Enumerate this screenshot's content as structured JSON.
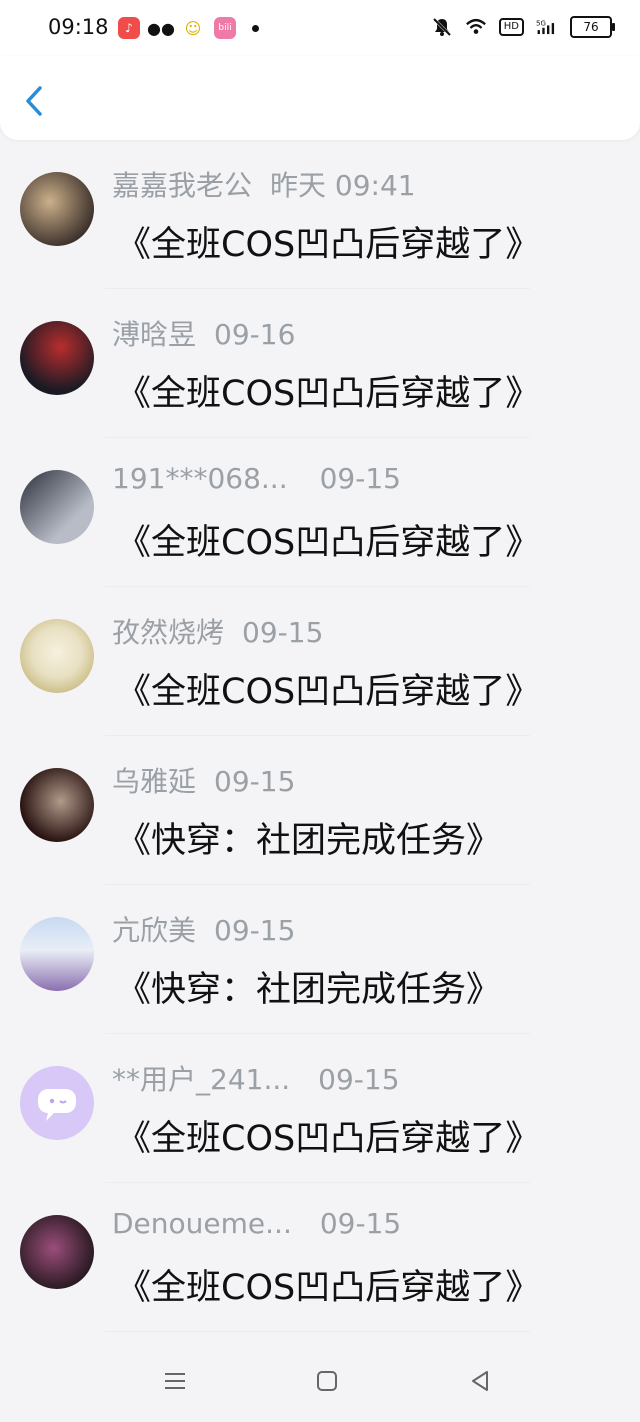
{
  "status_bar": {
    "time": "09:18",
    "battery": "76",
    "hd": "HD",
    "signal": "5G"
  },
  "header": {
    "back_icon": "chevron-left-icon"
  },
  "list": [
    {
      "name": "嘉嘉我老公",
      "time": "昨天 09:41",
      "message": "《全班COS凹凸后穿越了》",
      "avatar_colors": [
        "#3a2f2a",
        "#cbb08a"
      ]
    },
    {
      "name": "溥晗昱",
      "time": "09-16",
      "message": "《全班COS凹凸后穿越了》",
      "avatar_colors": [
        "#1a1a24",
        "#b82d2d"
      ]
    },
    {
      "name": "191***068...",
      "time": "09-15",
      "message": "《全班COS凹凸后穿越了》",
      "avatar_colors": [
        "#2b2f3a",
        "#b7bcc7"
      ]
    },
    {
      "name": "孜然烧烤",
      "time": "09-15",
      "message": "《全班COS凹凸后穿越了》",
      "avatar_colors": [
        "#e8e0c2",
        "#b6a35a"
      ]
    },
    {
      "name": "乌雅延",
      "time": "09-15",
      "message": "《快穿：社团完成任务》",
      "avatar_colors": [
        "#2a1412",
        "#b09a8a"
      ]
    },
    {
      "name": "亢欣美",
      "time": "09-15",
      "message": "《快穿：社团完成任务》",
      "avatar_colors": [
        "#c7d9f2",
        "#8b6fb0"
      ]
    },
    {
      "name": "**用户_241...",
      "time": "09-15",
      "message": "《全班COS凹凸后穿越了》",
      "avatar_colors": [
        "#d7c8f7",
        "#ffffff"
      ]
    },
    {
      "name": "Denoueme...",
      "time": "09-15",
      "message": "《全班COS凹凸后穿越了》",
      "avatar_colors": [
        "#2c1b24",
        "#9b4e7b"
      ]
    }
  ]
}
